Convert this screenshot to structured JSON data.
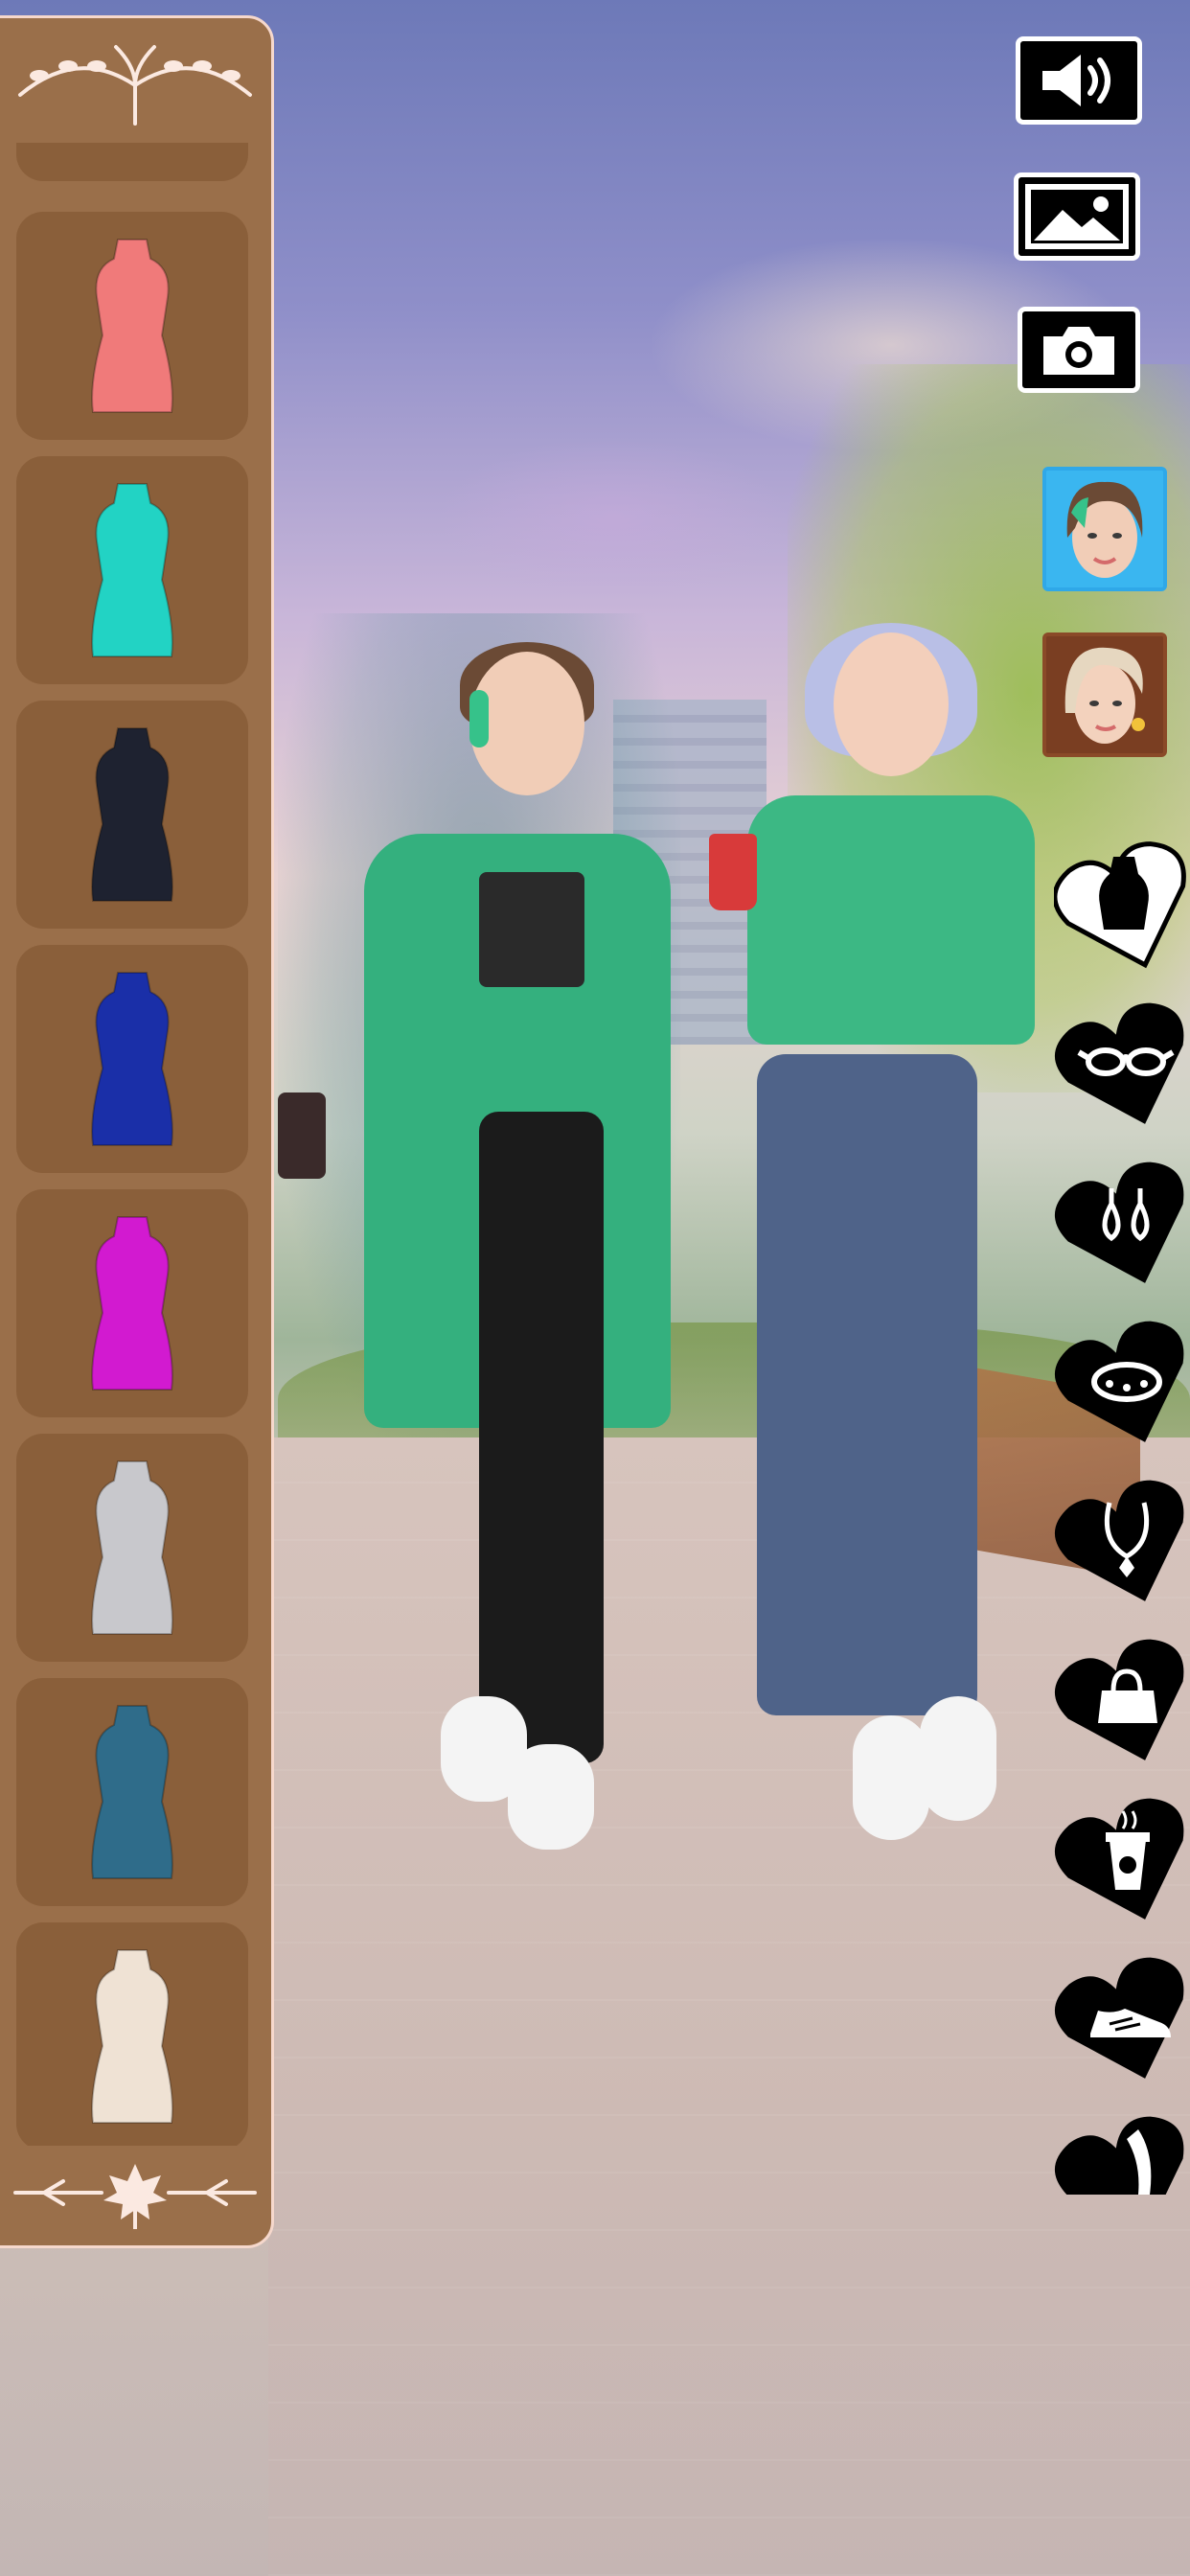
{
  "sound_button": {
    "icon": "speaker-icon"
  },
  "background_button": {
    "icon": "image-icon"
  },
  "camera_button": {
    "icon": "camera-icon"
  },
  "characters": [
    {
      "name": "character-brunette",
      "hair": "#6b4a35",
      "accent": "#36c28a",
      "frame": "#2fa8e8"
    },
    {
      "name": "character-blonde",
      "hair": "#e6d7c0",
      "accent": "#f2c23a",
      "frame": "#8a4a28"
    }
  ],
  "categories": [
    {
      "name": "dress",
      "icon": "dress-icon",
      "selected": true
    },
    {
      "name": "glasses",
      "icon": "glasses-icon",
      "selected": false
    },
    {
      "name": "earrings",
      "icon": "earrings-icon",
      "selected": false
    },
    {
      "name": "bracelet",
      "icon": "bracelet-icon",
      "selected": false
    },
    {
      "name": "necklace",
      "icon": "necklace-icon",
      "selected": false
    },
    {
      "name": "bag",
      "icon": "bag-icon",
      "selected": false
    },
    {
      "name": "drink",
      "icon": "coffee-cup-icon",
      "selected": false
    },
    {
      "name": "shoes",
      "icon": "sneaker-icon",
      "selected": false
    },
    {
      "name": "legs",
      "icon": "leg-icon",
      "selected": false
    }
  ],
  "dresses": [
    {
      "name": "dress-pink-turtleneck",
      "color": "#f07a7a"
    },
    {
      "name": "dress-turquoise-turtleneck",
      "color": "#22d3c4"
    },
    {
      "name": "dress-black-satin",
      "color": "#1e2230"
    },
    {
      "name": "dress-blue-satin",
      "color": "#1a2fa8"
    },
    {
      "name": "dress-magenta",
      "color": "#d21ad0"
    },
    {
      "name": "dress-silver-asymmetric",
      "color": "#c8c8cc"
    },
    {
      "name": "dress-sequin-teal",
      "color": "#2f6c8a"
    },
    {
      "name": "dress-lace-cream",
      "color": "#efe2d4"
    }
  ],
  "colors": {
    "panel": "#9a6f4a",
    "slot": "#8a5f3a",
    "panel_border": "#f6d8cc",
    "heart_tab": "#000000",
    "heart_tab_selected": "#ffffff"
  }
}
